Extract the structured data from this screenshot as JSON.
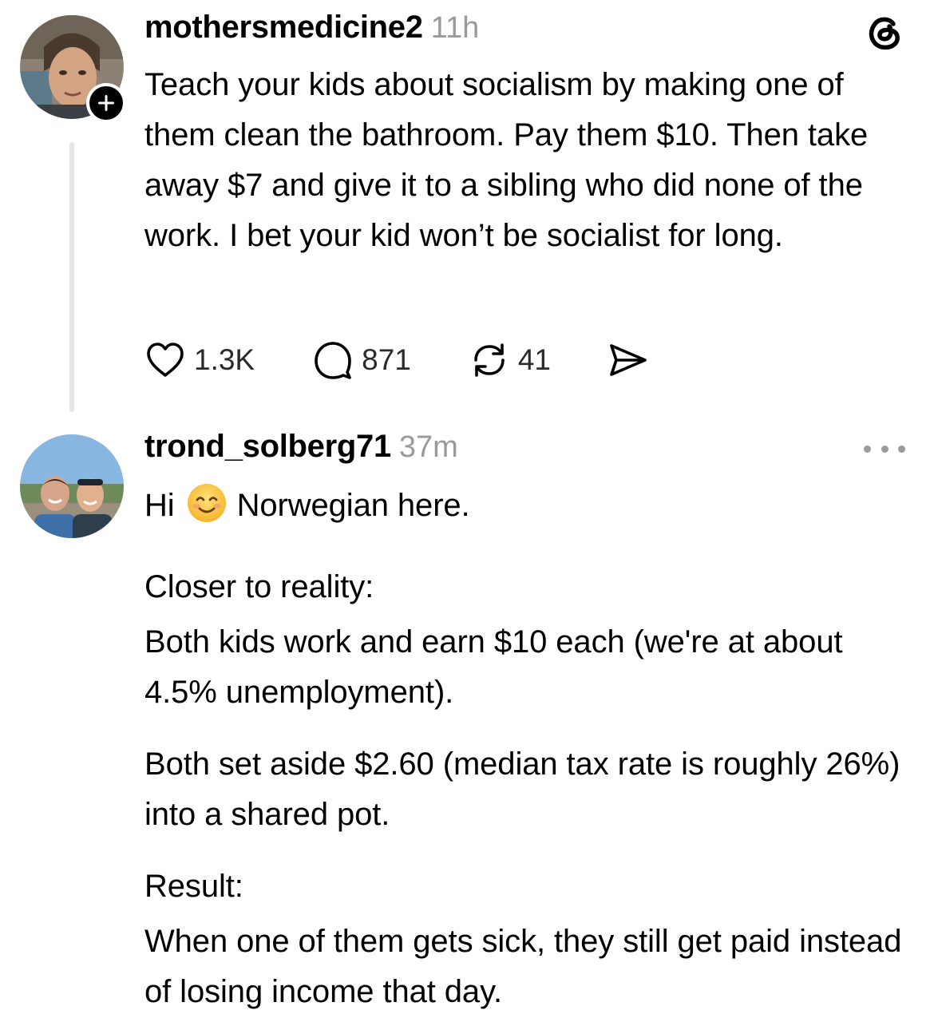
{
  "app": {
    "brand_icon": "threads-logo-icon"
  },
  "original_post": {
    "username": "mothersmedicine2",
    "timestamp": "11h",
    "avatar_icon": "profile-avatar",
    "follow_icon": "plus-icon",
    "text": "Teach your kids about socialism by making one of them clean the bathroom.  Pay them $10.  Then take away $7 and give it to a sibling who did none of the work.  I bet your kid won’t be socialist for long.",
    "actions": {
      "likes": "1.3K",
      "replies": "871",
      "reposts": "41",
      "like_icon": "heart-icon",
      "reply_icon": "comment-bubble-icon",
      "repost_icon": "repost-icon",
      "share_icon": "send-icon"
    }
  },
  "reply": {
    "username": "trond_solberg71",
    "timestamp": "37m",
    "avatar_icon": "profile-avatar",
    "more_icon": "more-horizontal-icon",
    "greeting_start": "Hi",
    "greeting_emoji": "smiling-face-emoji",
    "greeting_end": "Norwegian here.",
    "closer_label": "Closer to reality:",
    "closer_text": "Both kids work and earn $10 each (we're at about 4.5% unemployment).",
    "tax_text": "Both set aside $2.60 (median tax rate is roughly 26%) into a shared pot.",
    "result_label": "Result:",
    "result_text": "When one of them gets sick, they still get paid instead of losing income that day."
  },
  "colors": {
    "text": "#000000",
    "muted": "#9a9a9a",
    "thread_line": "#e6e6e6",
    "background": "#ffffff"
  }
}
